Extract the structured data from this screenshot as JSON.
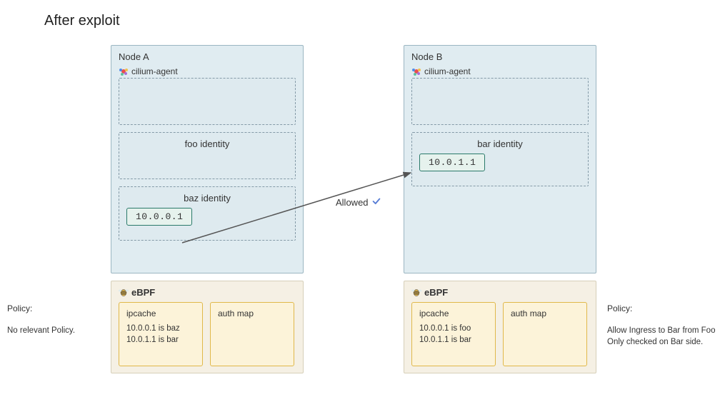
{
  "title": "After exploit",
  "nodeA": {
    "title": "Node A",
    "agent": "cilium-agent",
    "identity1": "foo identity",
    "identity2": "baz identity",
    "ip": "10.0.0.1"
  },
  "nodeB": {
    "title": "Node B",
    "agent": "cilium-agent",
    "identity1": "bar identity",
    "ip": "10.0.1.1"
  },
  "ebpf": {
    "title": "eBPF",
    "ipcache_title": "ipcache",
    "authmap_title": "auth map"
  },
  "ebpfA": {
    "line1": "10.0.0.1 is baz",
    "line2": "10.0.1.1 is bar"
  },
  "ebpfB": {
    "line1": "10.0.0.1 is foo",
    "line2": "10.0.1.1 is bar"
  },
  "policyA": {
    "label": "Policy:",
    "text": "No relevant Policy."
  },
  "policyB": {
    "label": "Policy:",
    "line1": "Allow Ingress to Bar from Foo",
    "line2": "Only checked on Bar side."
  },
  "arrow": {
    "label": "Allowed"
  }
}
